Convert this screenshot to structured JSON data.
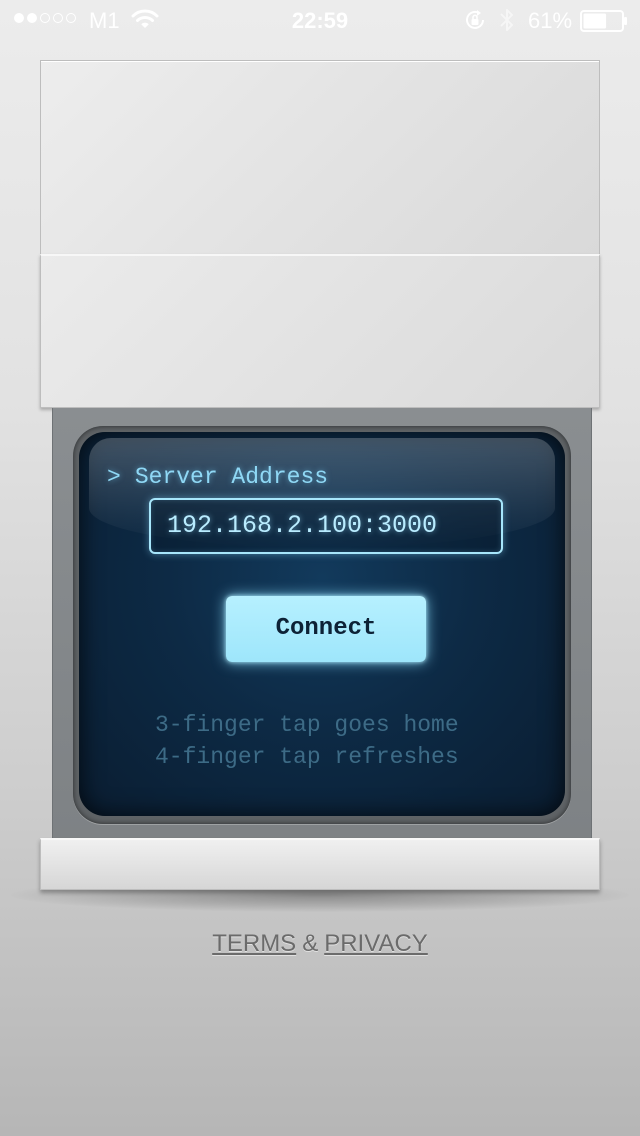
{
  "status_bar": {
    "signal_bars_filled": 2,
    "signal_bars_total": 5,
    "carrier": "M1",
    "wifi_icon": "wifi-icon",
    "time": "22:59",
    "rotation_lock_icon": "rotation-lock-icon",
    "bluetooth_icon": "bluetooth-icon",
    "battery_percent": "61%",
    "battery_level": 0.61
  },
  "terminal": {
    "prompt_caret": ">",
    "prompt_label": "Server Address",
    "server_address_value": "192.168.2.100:3000",
    "connect_label": "Connect",
    "hint_line_1": "3-finger tap goes home",
    "hint_line_2": "4-finger tap refreshes",
    "colors": {
      "screen_bg": "#0d2a45",
      "accent": "#a7e6fb",
      "button_bg": "#a8eafc",
      "hint_text": "#3d6b86"
    }
  },
  "footer": {
    "terms_label": "TERMS",
    "ampersand": "&",
    "privacy_label": "PRIVACY"
  }
}
